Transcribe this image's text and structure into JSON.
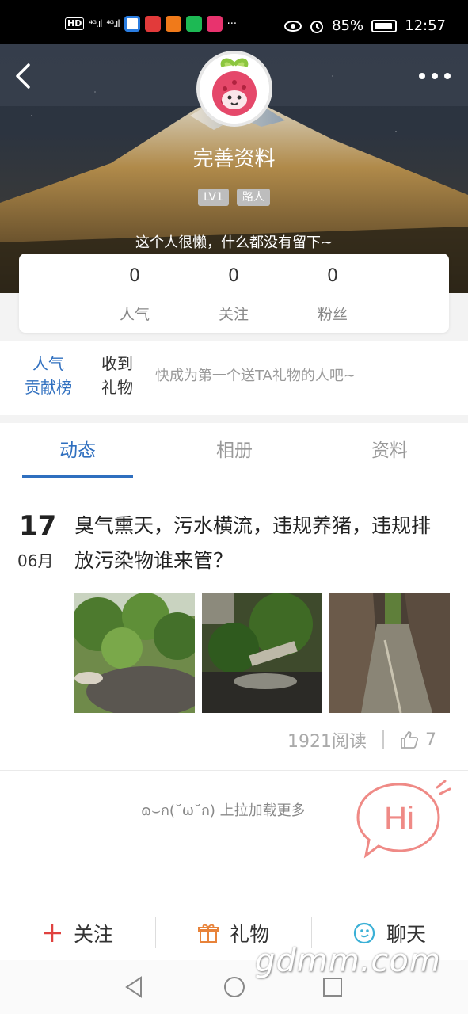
{
  "status_bar": {
    "hd": "HD",
    "signal1": "⁴ᴳ.ıl",
    "signal2": "⁴ᴳ.ıl",
    "more": "···",
    "battery": "85%",
    "time": "12:57"
  },
  "profile": {
    "nickname": "完善资料",
    "level": "LV1",
    "rank": "路人",
    "signature": "这个人很懒，什么都没有留下~"
  },
  "stats": [
    {
      "value": "0",
      "label": "人气"
    },
    {
      "value": "0",
      "label": "关注"
    },
    {
      "value": "0",
      "label": "粉丝"
    }
  ],
  "gift": {
    "rank_line1": "人气",
    "rank_line2": "贡献榜",
    "received_line1": "收到",
    "received_line2": "礼物",
    "hint": "快成为第一个送TA礼物的人吧~"
  },
  "tabs": [
    {
      "label": "动态",
      "active": true
    },
    {
      "label": "相册",
      "active": false
    },
    {
      "label": "资料",
      "active": false
    }
  ],
  "post": {
    "day": "17",
    "month": "06月",
    "text": "臭气熏天，污水横流，违规养猪，违规排放污染物谁来管？",
    "reads": "1921阅读",
    "likes": "7"
  },
  "load_more": "ɷ⌣ก(˘ω˘ก) 上拉加载更多",
  "hi_label": "Hi",
  "actions": {
    "follow": "关注",
    "gift": "礼物",
    "chat": "聊天"
  },
  "watermark": "gdmm.com",
  "colors": {
    "accent_blue": "#2f6fbf",
    "follow_red": "#e0423f",
    "gift_orange": "#e8833a",
    "chat_cyan": "#3bb0d6",
    "hi_pink": "#ef8a86"
  }
}
